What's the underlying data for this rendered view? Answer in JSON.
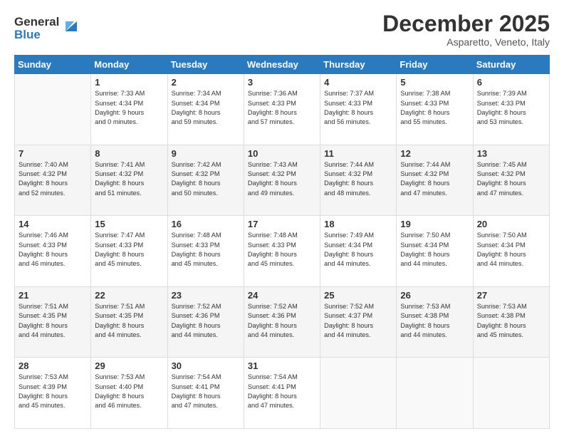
{
  "logo": {
    "line1": "General",
    "line2": "Blue"
  },
  "header": {
    "month": "December 2025",
    "location": "Asparetto, Veneto, Italy"
  },
  "weekdays": [
    "Sunday",
    "Monday",
    "Tuesday",
    "Wednesday",
    "Thursday",
    "Friday",
    "Saturday"
  ],
  "weeks": [
    [
      {
        "day": "",
        "info": ""
      },
      {
        "day": "1",
        "info": "Sunrise: 7:33 AM\nSunset: 4:34 PM\nDaylight: 9 hours\nand 0 minutes."
      },
      {
        "day": "2",
        "info": "Sunrise: 7:34 AM\nSunset: 4:34 PM\nDaylight: 8 hours\nand 59 minutes."
      },
      {
        "day": "3",
        "info": "Sunrise: 7:36 AM\nSunset: 4:33 PM\nDaylight: 8 hours\nand 57 minutes."
      },
      {
        "day": "4",
        "info": "Sunrise: 7:37 AM\nSunset: 4:33 PM\nDaylight: 8 hours\nand 56 minutes."
      },
      {
        "day": "5",
        "info": "Sunrise: 7:38 AM\nSunset: 4:33 PM\nDaylight: 8 hours\nand 55 minutes."
      },
      {
        "day": "6",
        "info": "Sunrise: 7:39 AM\nSunset: 4:33 PM\nDaylight: 8 hours\nand 53 minutes."
      }
    ],
    [
      {
        "day": "7",
        "info": "Sunrise: 7:40 AM\nSunset: 4:32 PM\nDaylight: 8 hours\nand 52 minutes."
      },
      {
        "day": "8",
        "info": "Sunrise: 7:41 AM\nSunset: 4:32 PM\nDaylight: 8 hours\nand 51 minutes."
      },
      {
        "day": "9",
        "info": "Sunrise: 7:42 AM\nSunset: 4:32 PM\nDaylight: 8 hours\nand 50 minutes."
      },
      {
        "day": "10",
        "info": "Sunrise: 7:43 AM\nSunset: 4:32 PM\nDaylight: 8 hours\nand 49 minutes."
      },
      {
        "day": "11",
        "info": "Sunrise: 7:44 AM\nSunset: 4:32 PM\nDaylight: 8 hours\nand 48 minutes."
      },
      {
        "day": "12",
        "info": "Sunrise: 7:44 AM\nSunset: 4:32 PM\nDaylight: 8 hours\nand 47 minutes."
      },
      {
        "day": "13",
        "info": "Sunrise: 7:45 AM\nSunset: 4:32 PM\nDaylight: 8 hours\nand 47 minutes."
      }
    ],
    [
      {
        "day": "14",
        "info": "Sunrise: 7:46 AM\nSunset: 4:33 PM\nDaylight: 8 hours\nand 46 minutes."
      },
      {
        "day": "15",
        "info": "Sunrise: 7:47 AM\nSunset: 4:33 PM\nDaylight: 8 hours\nand 45 minutes."
      },
      {
        "day": "16",
        "info": "Sunrise: 7:48 AM\nSunset: 4:33 PM\nDaylight: 8 hours\nand 45 minutes."
      },
      {
        "day": "17",
        "info": "Sunrise: 7:48 AM\nSunset: 4:33 PM\nDaylight: 8 hours\nand 45 minutes."
      },
      {
        "day": "18",
        "info": "Sunrise: 7:49 AM\nSunset: 4:34 PM\nDaylight: 8 hours\nand 44 minutes."
      },
      {
        "day": "19",
        "info": "Sunrise: 7:50 AM\nSunset: 4:34 PM\nDaylight: 8 hours\nand 44 minutes."
      },
      {
        "day": "20",
        "info": "Sunrise: 7:50 AM\nSunset: 4:34 PM\nDaylight: 8 hours\nand 44 minutes."
      }
    ],
    [
      {
        "day": "21",
        "info": "Sunrise: 7:51 AM\nSunset: 4:35 PM\nDaylight: 8 hours\nand 44 minutes."
      },
      {
        "day": "22",
        "info": "Sunrise: 7:51 AM\nSunset: 4:35 PM\nDaylight: 8 hours\nand 44 minutes."
      },
      {
        "day": "23",
        "info": "Sunrise: 7:52 AM\nSunset: 4:36 PM\nDaylight: 8 hours\nand 44 minutes."
      },
      {
        "day": "24",
        "info": "Sunrise: 7:52 AM\nSunset: 4:36 PM\nDaylight: 8 hours\nand 44 minutes."
      },
      {
        "day": "25",
        "info": "Sunrise: 7:52 AM\nSunset: 4:37 PM\nDaylight: 8 hours\nand 44 minutes."
      },
      {
        "day": "26",
        "info": "Sunrise: 7:53 AM\nSunset: 4:38 PM\nDaylight: 8 hours\nand 44 minutes."
      },
      {
        "day": "27",
        "info": "Sunrise: 7:53 AM\nSunset: 4:38 PM\nDaylight: 8 hours\nand 45 minutes."
      }
    ],
    [
      {
        "day": "28",
        "info": "Sunrise: 7:53 AM\nSunset: 4:39 PM\nDaylight: 8 hours\nand 45 minutes."
      },
      {
        "day": "29",
        "info": "Sunrise: 7:53 AM\nSunset: 4:40 PM\nDaylight: 8 hours\nand 46 minutes."
      },
      {
        "day": "30",
        "info": "Sunrise: 7:54 AM\nSunset: 4:41 PM\nDaylight: 8 hours\nand 47 minutes."
      },
      {
        "day": "31",
        "info": "Sunrise: 7:54 AM\nSunset: 4:41 PM\nDaylight: 8 hours\nand 47 minutes."
      },
      {
        "day": "",
        "info": ""
      },
      {
        "day": "",
        "info": ""
      },
      {
        "day": "",
        "info": ""
      }
    ]
  ]
}
